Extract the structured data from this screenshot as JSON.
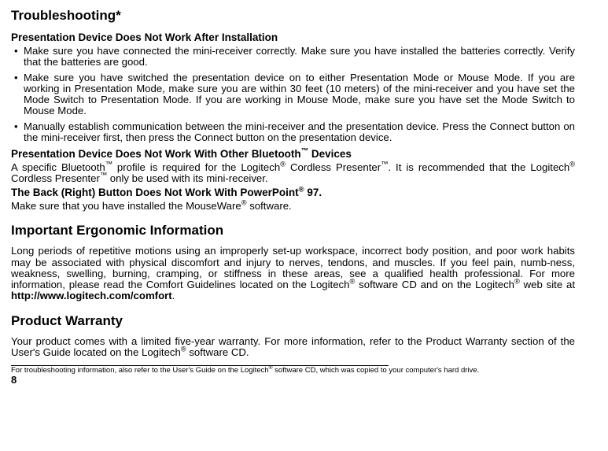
{
  "troubleshooting": {
    "title": "Troubleshooting*",
    "sub1": {
      "heading": "Presentation Device Does Not Work After Installation",
      "items": [
        "Make sure you have connected the mini-receiver correctly. Make sure you have installed the batteries correctly. Verify that the batteries are good.",
        "Make sure you have switched the presentation device on to either Presentation Mode or Mouse Mode. If you are working in Presentation Mode, make sure you are within 30 feet (10 meters) of the mini-receiver and you have set the Mode Switch to Presentation Mode. If you are working in Mouse Mode, make sure you have set the Mode Switch to Mouse Mode.",
        "Manually establish communication between the mini-receiver and the presentation device. Press the Connect button on the mini-receiver first, then press the Connect button on the presentation device."
      ]
    },
    "sub2": {
      "heading_pre": "Presentation Device Does Not Work With Other Bluetooth",
      "heading_post": " Devices",
      "para_p1": "A specific Bluetooth",
      "para_p2": " profile is required for the Logitech",
      "para_p3": " Cordless Presenter",
      "para_p4": ". It is recommended that the Logitech",
      "para_p5": " Cordless Presenter",
      "para_p6": " only be used with its mini-receiver."
    },
    "sub3": {
      "heading_pre": "The Back (Right) Button Does Not Work With PowerPoint",
      "heading_post": " 97.",
      "para_p1": "Make sure that you have installed the MouseWare",
      "para_p2": " software."
    }
  },
  "ergo": {
    "title": "Important Ergonomic Information",
    "para_p1": "Long periods of repetitive motions using an improperly set-up workspace, incorrect body position, and poor work habits may be associated with physical discomfort and injury to nerves, tendons, and muscles. If you feel pain, numb-ness, weakness, swelling, burning, cramping, or stiffness in these areas, see a qualified health professional. For more information, please read the Comfort Guidelines located on the Logitech",
    "para_p2": " software CD and on the Logitech",
    "para_p3": " web site at ",
    "url": "http://www.logitech.com/comfort",
    "para_p4": "."
  },
  "warranty": {
    "title": "Product Warranty",
    "para_p1": "Your product comes with a limited five-year warranty. For more information, refer to the Product Warranty section of the User's Guide located on the Logitech",
    "para_p2": " software CD."
  },
  "footnote": {
    "text_p1": "For troubleshooting information, also refer to the User's Guide on the Logitech",
    "text_p2": " software CD, which was copied to your computer's hard drive."
  },
  "page_number": "8",
  "sup": {
    "tm": "™",
    "reg": "®"
  }
}
